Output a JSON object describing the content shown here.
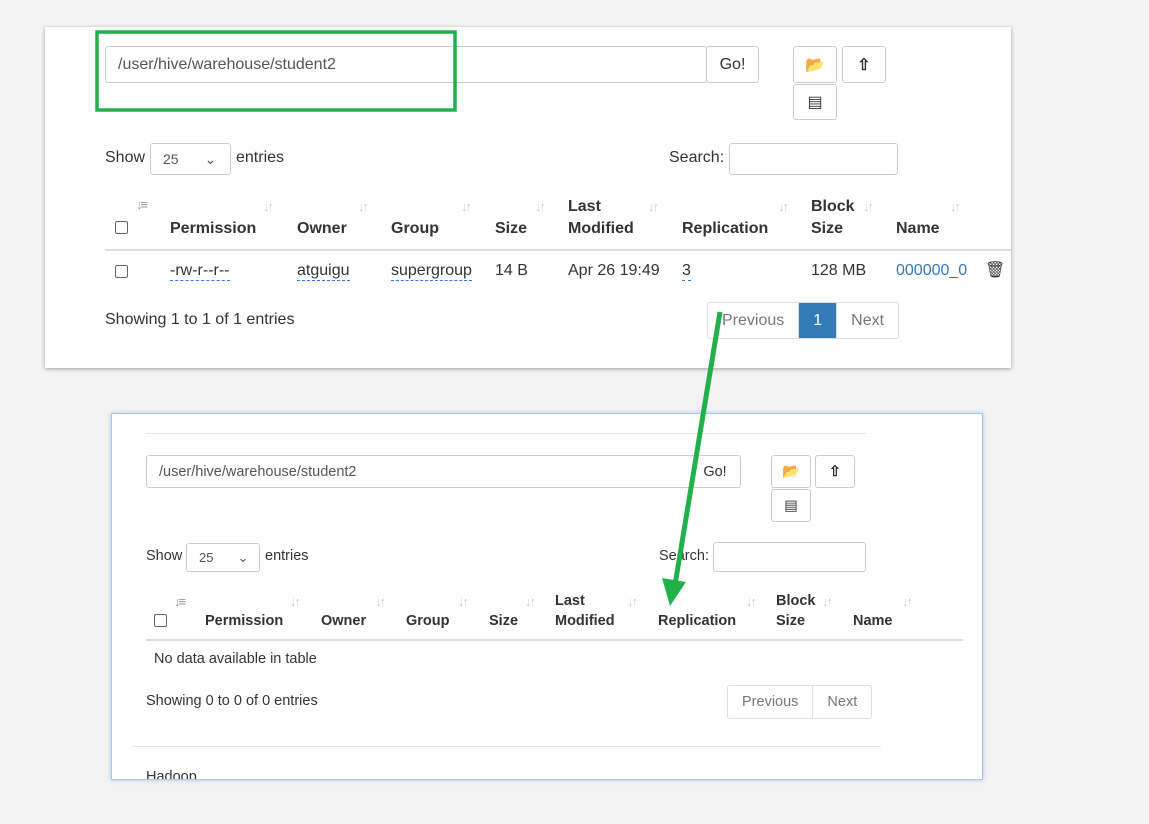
{
  "top": {
    "path": "/user/hive/warehouse/student2",
    "go": "Go!",
    "show": "Show",
    "entries_value": "25",
    "entries": "entries",
    "search": "Search:",
    "headers": [
      "Permission",
      "Owner",
      "Group",
      "Size",
      "Last",
      "Modified",
      "Replication",
      "Block",
      "Size",
      "Name"
    ],
    "row": {
      "permission": "-rw-r--r--",
      "owner": "atguigu",
      "group": "supergroup",
      "size": "14 B",
      "modified": "Apr 26 19:49",
      "replication": "3",
      "block_size": "128 MB",
      "name": "000000_0"
    },
    "info": "Showing 1 to 1 of 1 entries",
    "prev": "Previous",
    "page": "1",
    "next": "Next"
  },
  "bottom": {
    "path": "/user/hive/warehouse/student2",
    "go": "Go!",
    "show": "Show",
    "entries_value": "25",
    "entries": "entries",
    "search": "Search:",
    "headers": [
      "Permission",
      "Owner",
      "Group",
      "Size",
      "Last",
      "Modified",
      "Replication",
      "Block",
      "Size",
      "Name"
    ],
    "empty": "No data available in table",
    "info": "Showing 0 to 0 of 0 entries",
    "prev": "Previous",
    "next": "Next",
    "footer": "Hadoop,"
  },
  "annotation_color": "#22b04b"
}
